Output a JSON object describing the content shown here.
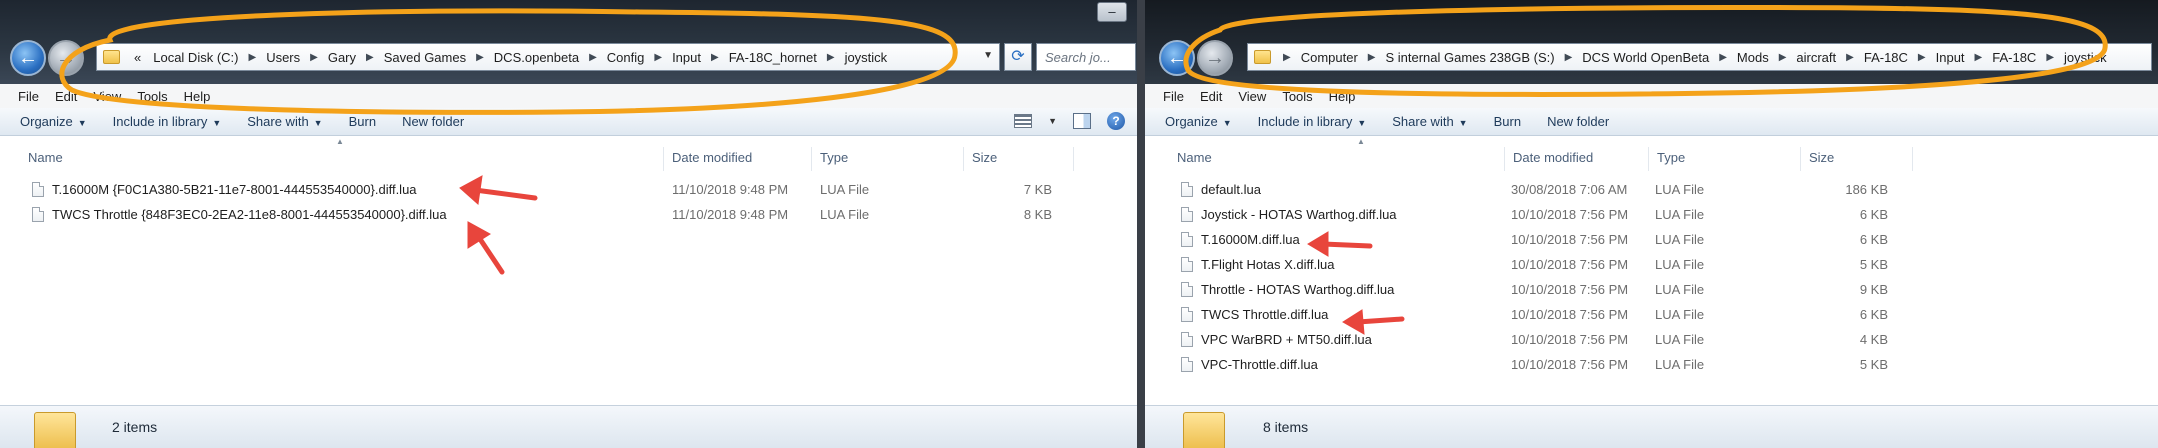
{
  "left_window": {
    "breadcrumb": [
      "«",
      "Local Disk (C:)",
      "Users",
      "Gary",
      "Saved Games",
      "DCS.openbeta",
      "Config",
      "Input",
      "FA-18C_hornet",
      "joystick"
    ],
    "search_placeholder": "Search jo...",
    "menu": [
      "File",
      "Edit",
      "View",
      "Tools",
      "Help"
    ],
    "toolbar": [
      "Organize",
      "Include in library",
      "Share with",
      "Burn",
      "New folder"
    ],
    "columns": [
      "Name",
      "Date modified",
      "Type",
      "Size"
    ],
    "files": [
      {
        "name": "T.16000M {F0C1A380-5B21-11e7-8001-444553540000}.diff.lua",
        "date": "11/10/2018 9:48 PM",
        "type": "LUA File",
        "size": "7 KB"
      },
      {
        "name": "TWCS Throttle {848F3EC0-2EA2-11e8-8001-444553540000}.diff.lua",
        "date": "11/10/2018 9:48 PM",
        "type": "LUA File",
        "size": "8 KB"
      }
    ],
    "status": "2 items"
  },
  "right_window": {
    "breadcrumb": [
      "Computer",
      "S internal Games 238GB (S:)",
      "DCS World OpenBeta",
      "Mods",
      "aircraft",
      "FA-18C",
      "Input",
      "FA-18C",
      "joystick"
    ],
    "menu": [
      "File",
      "Edit",
      "View",
      "Tools",
      "Help"
    ],
    "toolbar": [
      "Organize",
      "Include in library",
      "Share with",
      "Burn",
      "New folder"
    ],
    "columns": [
      "Name",
      "Date modified",
      "Type",
      "Size"
    ],
    "files": [
      {
        "name": "default.lua",
        "date": "30/08/2018 7:06 AM",
        "type": "LUA File",
        "size": "186 KB"
      },
      {
        "name": "Joystick - HOTAS Warthog.diff.lua",
        "date": "10/10/2018 7:56 PM",
        "type": "LUA File",
        "size": "6 KB"
      },
      {
        "name": "T.16000M.diff.lua",
        "date": "10/10/2018 7:56 PM",
        "type": "LUA File",
        "size": "6 KB"
      },
      {
        "name": "T.Flight Hotas X.diff.lua",
        "date": "10/10/2018 7:56 PM",
        "type": "LUA File",
        "size": "5 KB"
      },
      {
        "name": "Throttle - HOTAS Warthog.diff.lua",
        "date": "10/10/2018 7:56 PM",
        "type": "LUA File",
        "size": "9 KB"
      },
      {
        "name": "TWCS Throttle.diff.lua",
        "date": "10/10/2018 7:56 PM",
        "type": "LUA File",
        "size": "6 KB"
      },
      {
        "name": "VPC WarBRD + MT50.diff.lua",
        "date": "10/10/2018 7:56 PM",
        "type": "LUA File",
        "size": "4 KB"
      },
      {
        "name": "VPC-Throttle.diff.lua",
        "date": "10/10/2018 7:56 PM",
        "type": "LUA File",
        "size": "5 KB"
      }
    ],
    "status": "8 items"
  },
  "colors": {
    "annotation_ellipse": "#f4a21a",
    "annotation_arrow": "#e8453c",
    "selection_blue": "#2a6fc2"
  }
}
